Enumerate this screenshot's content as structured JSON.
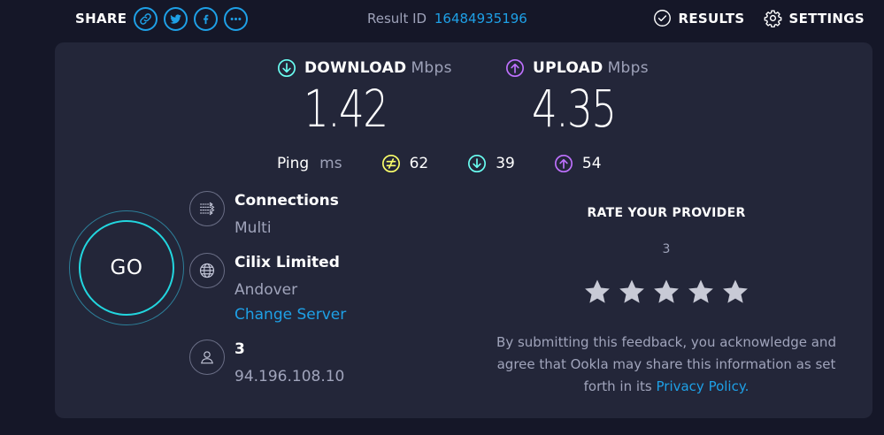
{
  "share": {
    "label": "SHARE",
    "buttons": [
      "link-icon",
      "twitter-icon",
      "facebook-icon",
      "more-icon"
    ]
  },
  "result": {
    "label": "Result ID",
    "id": "16484935196"
  },
  "nav": {
    "results_label": "RESULTS",
    "settings_label": "SETTINGS"
  },
  "download": {
    "label": "DOWNLOAD",
    "unit": "Mbps",
    "value": "1.42",
    "color": "#6afff3"
  },
  "upload": {
    "label": "UPLOAD",
    "unit": "Mbps",
    "value": "4.35",
    "color": "#bf71ff"
  },
  "ping": {
    "label": "Ping",
    "unit": "ms",
    "idle": "62",
    "download": "39",
    "upload": "54",
    "idle_color": "#fbff6a"
  },
  "go": {
    "label": "GO"
  },
  "connections": {
    "title": "Connections",
    "value": "Multi"
  },
  "server": {
    "name": "Cilix Limited",
    "location": "Andover",
    "change_label": "Change Server"
  },
  "provider": {
    "name": "3",
    "ip": "94.196.108.10"
  },
  "rating": {
    "title": "RATE YOUR PROVIDER",
    "provider": "3",
    "stars_total": 5,
    "disclaimer": "By submitting this feedback, you acknowledge and agree that Ookla may share this information as set forth in its",
    "privacy_label": "Privacy Policy."
  },
  "colors": {
    "background": "#151728",
    "card": "#232639",
    "accent": "#1ea0e6",
    "go_ring": "#22d6df"
  }
}
